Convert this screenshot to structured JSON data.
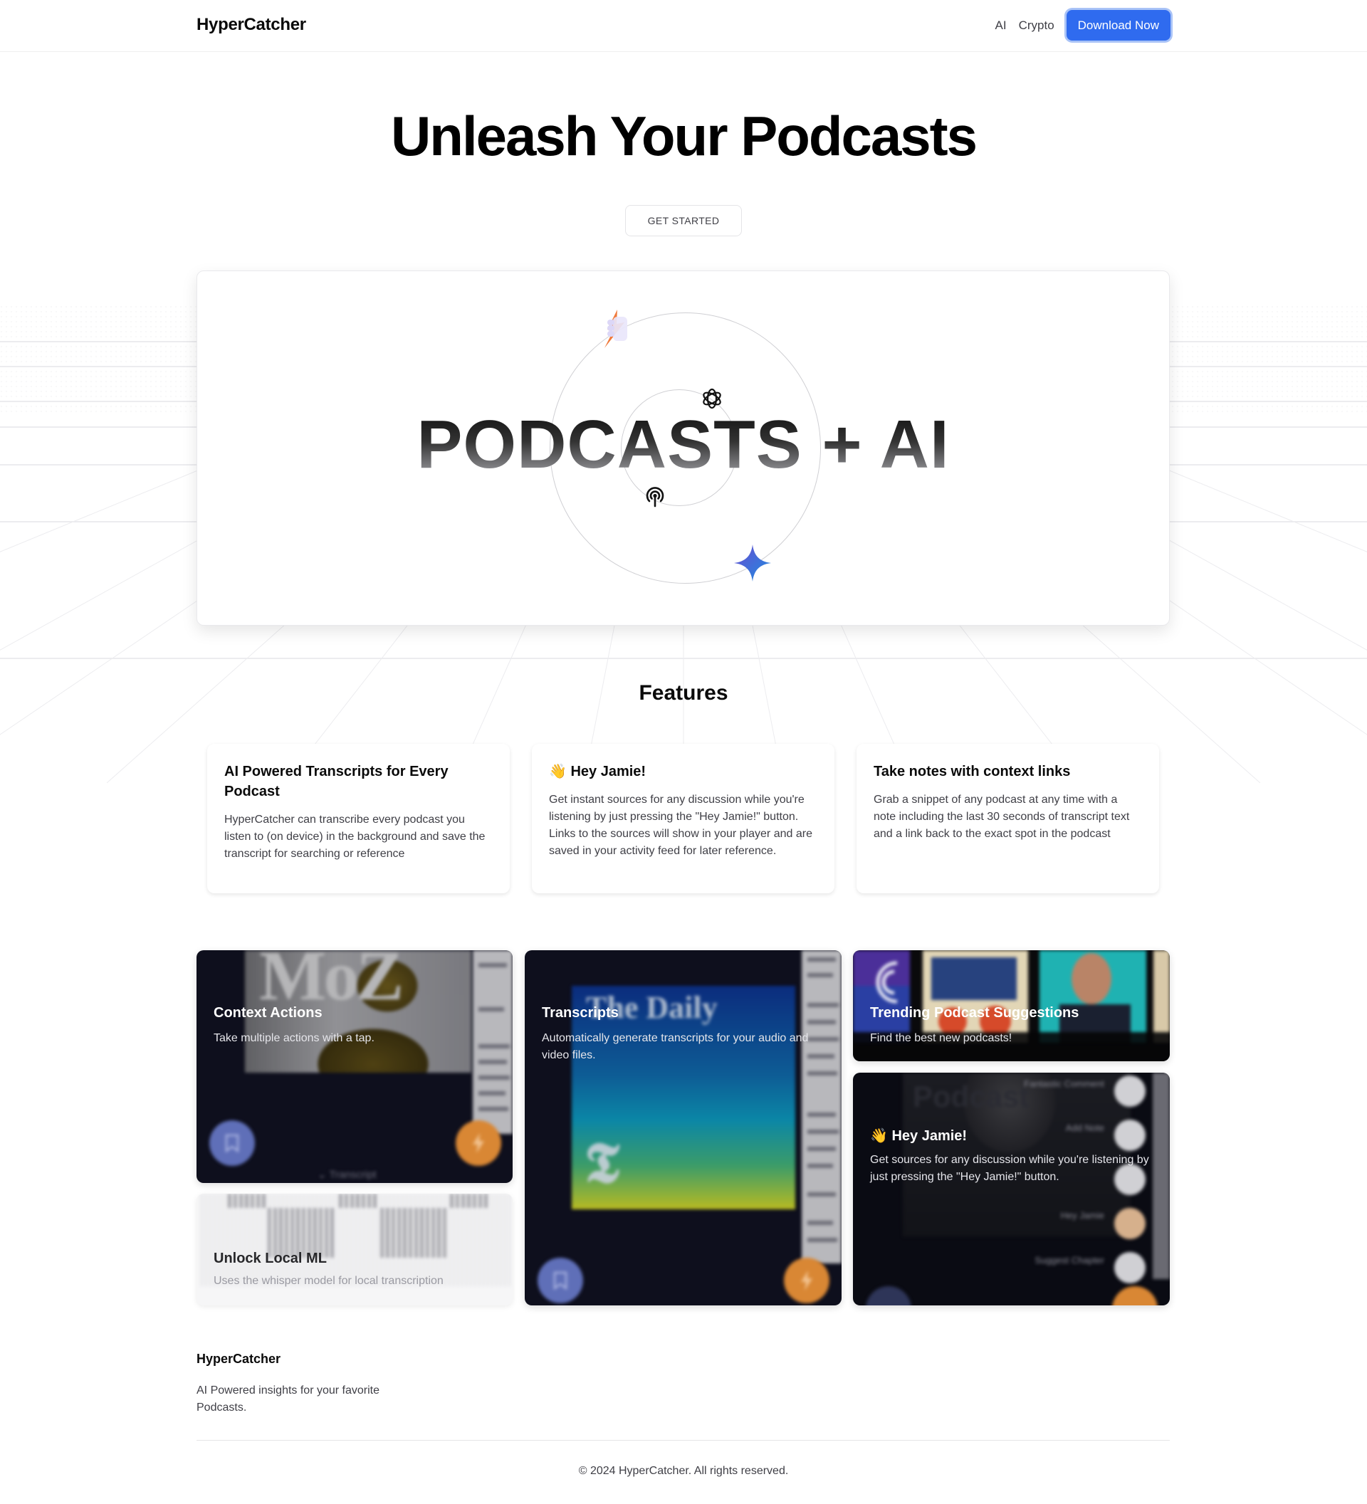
{
  "header": {
    "brand": "HyperCatcher",
    "nav": [
      {
        "label": "AI"
      },
      {
        "label": "Crypto"
      }
    ],
    "cta_label": "Download Now",
    "cta_color": "#2f6bef"
  },
  "hero": {
    "title": "Unleash Your Podcasts",
    "button_label": "GET STARTED"
  },
  "showcase": {
    "headline": "PODCASTS + AI",
    "icons": [
      "fist-lightning-icon",
      "openai-icon",
      "podcast-icon",
      "gemini-sparkle-icon"
    ]
  },
  "features": {
    "title": "Features",
    "cards": [
      {
        "title": "AI Powered Transcripts for Every Podcast",
        "body": "HyperCatcher can transcribe every podcast you listen to (on device) in the background and save the transcript for searching or reference"
      },
      {
        "title": "👋 Hey Jamie!",
        "body": "Get instant sources for any discussion while you're listening by just pressing the \"Hey Jamie!\" button. Links to the sources will show in your player and are saved in your activity feed for later reference."
      },
      {
        "title": "Take notes with context links",
        "body": "Grab a snippet of any podcast at any time with a note including the last 30 seconds of transcript text and a link back to the exact spot in the podcast"
      }
    ]
  },
  "bento": {
    "context_actions": {
      "title": "Context Actions",
      "desc": "Take multiple actions with a tap.",
      "art_text": "MoZ",
      "transcript_label": "Transcript"
    },
    "local_ml": {
      "title": "Unlock Local ML",
      "desc": "Uses the whisper model for local transcription"
    },
    "transcripts": {
      "title": "Transcripts",
      "desc": "Automatically generate transcripts for your audio and video files.",
      "art_text": "The Daily"
    },
    "trending": {
      "title": "Trending Podcast Suggestions",
      "desc": "Find the best new podcasts!"
    },
    "hey_jamie": {
      "title": "👋 Hey Jamie!",
      "desc": "Get sources for any discussion while you're listening by just pressing the \"Hey Jamie!\" button.",
      "art_text": "Podcast",
      "menu": [
        "Fantastic Comment",
        "Add Note",
        "Hey Jamie",
        "Suggest Chapter"
      ]
    },
    "colors": {
      "bookmark_fab": "#5f6fb8",
      "bolt_fab": "#d98734"
    }
  },
  "footer": {
    "brand": "HyperCatcher",
    "tagline": "AI Powered insights for your favorite Podcasts.",
    "copyright": "© 2024 HyperCatcher. All rights reserved."
  }
}
